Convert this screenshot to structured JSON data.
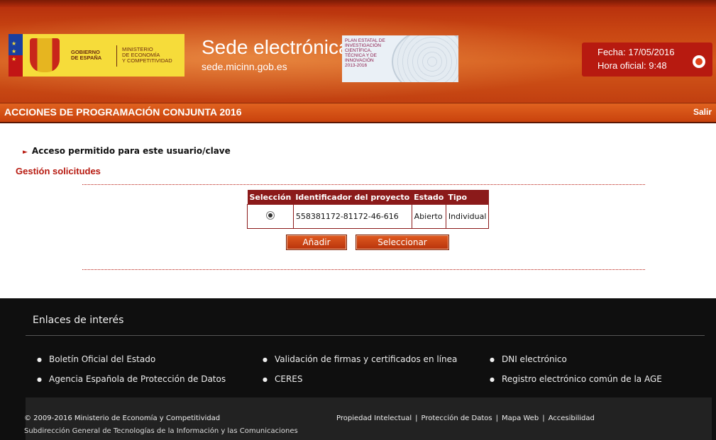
{
  "header": {
    "gov_logo": {
      "line1": "GOBIERNO",
      "line2": "DE ESPAÑA",
      "min1": "MINISTERIO",
      "min2": "DE ECONOMÍA",
      "min3": "Y COMPETITIVIDAD"
    },
    "site_title": "Sede electrónica",
    "site_url": "sede.micinn.gob.es",
    "plan": [
      "PLAN ESTATAL DE",
      "INVESTIGACIÓN",
      "CIENTÍFICA,",
      "TÉCNICA Y DE",
      "INNOVACIÓN",
      "2013-2016"
    ],
    "fecha": "Fecha: 17/05/2016",
    "hora": "Hora oficial: 9:48"
  },
  "titlebar": {
    "title": "ACCIONES DE PROGRAMACIÓN CONJUNTA 2016",
    "salir": "Salir"
  },
  "main": {
    "access_message": "Acceso permitido para este usuario/clave",
    "section_title": "Gestión solicitudes",
    "table": {
      "headers": [
        "Selección",
        "Identificador del proyecto",
        "Estado",
        "Tipo"
      ],
      "rows": [
        {
          "selected": true,
          "identificador": "558381172-81172-46-616",
          "estado": "Abierto",
          "tipo": "Individual"
        }
      ]
    },
    "buttons": {
      "add": "Añadir",
      "select": "Seleccionar"
    }
  },
  "footer": {
    "title": "Enlaces de interés",
    "links": [
      "Boletín Oficial del Estado",
      "Validación de firmas y certificados en línea",
      "DNI electrónico",
      "Agencia Española de Protección de Datos",
      "CERES",
      "Registro electrónico común de la AGE"
    ],
    "copyright": "© 2009-2016 Ministerio de Economía y Competitividad",
    "subdireccion": "Subdirección General de Tecnologías de la Información y las Comunicaciones",
    "bottom_links": [
      "Propiedad Intelectual",
      "Protección de Datos",
      "Mapa Web",
      "Accesibilidad"
    ],
    "separator": "|"
  },
  "colors": {
    "brand_red": "#b71a10",
    "header_orange": "#d4591a",
    "footer_bg": "#0f0f0f",
    "table_header": "#8b1a1a"
  }
}
